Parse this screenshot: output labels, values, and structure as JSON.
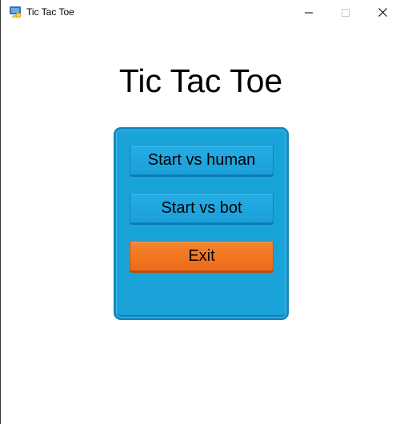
{
  "window": {
    "title": "Tic Tac Toe",
    "icons": [
      "app-icon",
      "minimize-icon",
      "maximize-icon",
      "close-icon"
    ]
  },
  "menu": {
    "heading": "Tic Tac Toe",
    "buttons": [
      {
        "label": "Start vs human",
        "color": "#1ba4dd"
      },
      {
        "label": "Start vs bot",
        "color": "#1ba4dd"
      },
      {
        "label": "Exit",
        "color": "#f07420"
      }
    ],
    "panel_color": "#1aa3d9"
  }
}
